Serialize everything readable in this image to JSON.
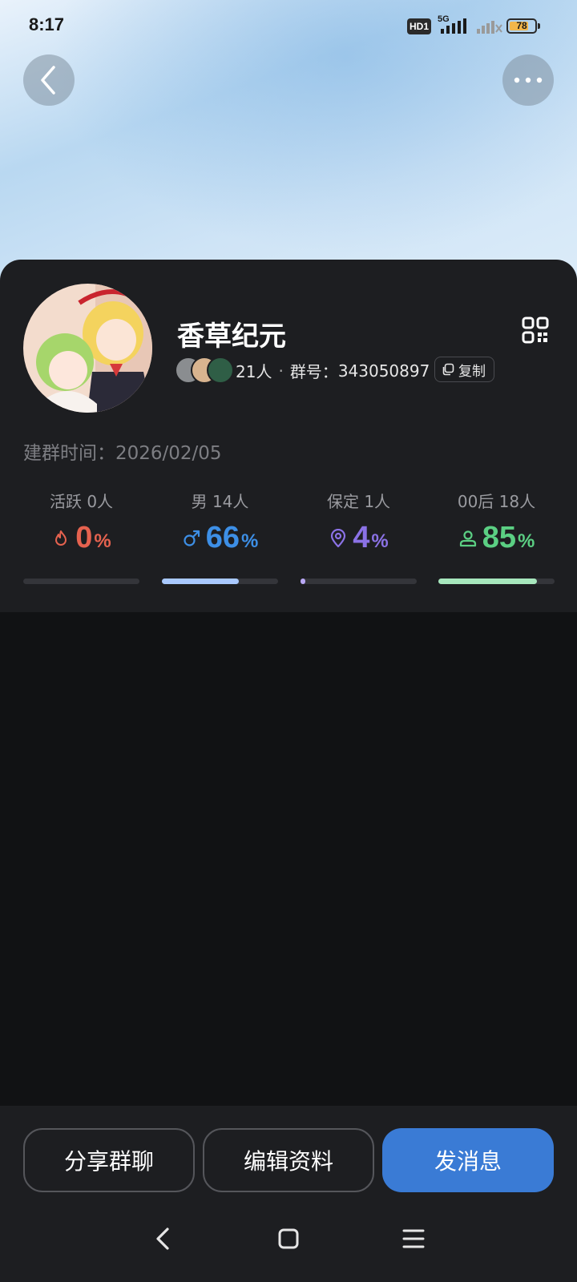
{
  "status_bar": {
    "time": "8:17",
    "hd_badge": "HD1",
    "network": "5G",
    "battery_level": "78",
    "battery_fraction": 0.78
  },
  "header": {
    "back_icon": "chevron-left-icon",
    "more_icon": "more-horizontal-icon"
  },
  "group": {
    "name": "香草纪元",
    "member_count_text": "21人",
    "group_id_label": "群号：",
    "group_id": "343050897",
    "copy_label": "复制",
    "created_label": "建群时间：",
    "created_date": "2026/02/05",
    "qr_icon": "qr-code-icon"
  },
  "stats": [
    {
      "label": "活跃",
      "count": "0人",
      "value": "0",
      "pct": "%",
      "icon": "flame-icon",
      "color": "#e5624f",
      "bar_color": "#3a3b40",
      "fraction": 0.0
    },
    {
      "label": "男",
      "count": "14人",
      "value": "66",
      "pct": "%",
      "icon": "male-icon",
      "color": "#3d8fe6",
      "bar_color": "#a9c9ff",
      "fraction": 0.66
    },
    {
      "label": "保定",
      "count": "1人",
      "value": "4",
      "pct": "%",
      "icon": "location-pin-icon",
      "color": "#8b72e6",
      "bar_color": "#b9a8f5",
      "fraction": 0.04
    },
    {
      "label": "00后",
      "count": "18人",
      "value": "85",
      "pct": "%",
      "icon": "person-icon",
      "color": "#5bcf83",
      "bar_color": "#a7e7bd",
      "fraction": 0.85
    }
  ],
  "actions": {
    "share_label": "分享群聊",
    "edit_label": "编辑资料",
    "message_label": "发消息"
  },
  "colors": {
    "card_bg": "#1d1e21",
    "page_bg": "#111214",
    "primary": "#3a7bd5"
  }
}
